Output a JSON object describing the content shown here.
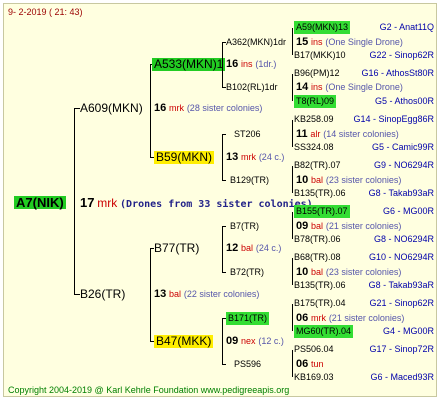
{
  "header": "9-  2-2019 ( 21: 43)",
  "footer": "Copyright 2004-2019 @ Karl Kehrle Foundation    www.pedigreeapis.org",
  "root": {
    "name": "A7(NIK)",
    "num": "17",
    "label": "mrk",
    "note": "(Drones from 33 sister colonies)"
  },
  "gen1": [
    {
      "name": "A609(MKN)",
      "num": "16",
      "label": "mrk",
      "sis": "(28 sister colonies)"
    },
    {
      "name": "B26(TR)",
      "num": "13",
      "label": "bal",
      "sis": "(22 sister colonies)"
    }
  ],
  "gen2": [
    {
      "name": "A533(MKN)1",
      "num": "16",
      "label": "ins",
      "sis": "(1dr.)"
    },
    {
      "name": "B59(MKN)",
      "num": "13",
      "label": "mrk",
      "sis": "(24 c.)"
    },
    {
      "name": "B77(TR)",
      "num": "12",
      "label": "bal",
      "sis": "(24 c.)"
    },
    {
      "name": "B47(MKK)",
      "num": "09",
      "label": "nex",
      "sis": "(12 c.)"
    }
  ],
  "gen3": [
    {
      "name": "A362(MKN)1dr",
      "num": "15",
      "label": "ins",
      "sis": "(One Single Drone)"
    },
    {
      "name": "B102(RL)1dr",
      "num": "14",
      "label": "ins",
      "sis": "(One Single Drone)"
    },
    {
      "name": "ST206",
      "num": "11",
      "label": "alr",
      "sis": "(14 sister colonies)"
    },
    {
      "name": "B129(TR)",
      "num": "10",
      "label": "bal",
      "sis": "(23 sister colonies)"
    },
    {
      "name": "B7(TR)",
      "num": "09",
      "label": "bal",
      "sis": "(21 sister colonies)"
    },
    {
      "name": "B72(TR)",
      "num": "10",
      "label": "bal",
      "sis": "(23 sister colonies)"
    },
    {
      "name": "B171(TR)",
      "num": "06",
      "label": "mrk",
      "sis": "(21 sister colonies)"
    },
    {
      "name": "PS596",
      "num": "06",
      "label": "tun",
      "sis": ""
    }
  ],
  "gen4": [
    {
      "name": "A59(MKN)13",
      "src": "G2 - Anat11Q"
    },
    {
      "name": "B17(MKK)10",
      "src": "G22 - Sinop62R"
    },
    {
      "name": "B96(PM)12",
      "src": "G16 - AthosSt80R"
    },
    {
      "name": "T8(RL)09",
      "src": "G5 - Athos00R"
    },
    {
      "name": "KB258.09",
      "src": "G14 - SinopEgg86R"
    },
    {
      "name": "SS324.08",
      "src": "G5 - Camic99R"
    },
    {
      "name": "B82(TR).07",
      "src": "G9 - NO6294R"
    },
    {
      "name": "B135(TR).06",
      "src": "G8 - Takab93aR"
    },
    {
      "name": "B155(TR).07",
      "src": "G6 - MG00R"
    },
    {
      "name": "B78(TR).06",
      "src": "G8 - NO6294R"
    },
    {
      "name": "B68(TR).08",
      "src": "G10 - NO6294R"
    },
    {
      "name": "B135(TR).06",
      "src": "G8 - Takab93aR"
    },
    {
      "name": "B175(TR).04",
      "src": "G21 - Sinop62R"
    },
    {
      "name": "MG60(TR).04",
      "src": "G4 - MG00R"
    },
    {
      "name": "PS506.04",
      "src": "G17 - Sinop72R"
    },
    {
      "name": "KB169.03",
      "src": "G6 - Maced93R"
    }
  ]
}
